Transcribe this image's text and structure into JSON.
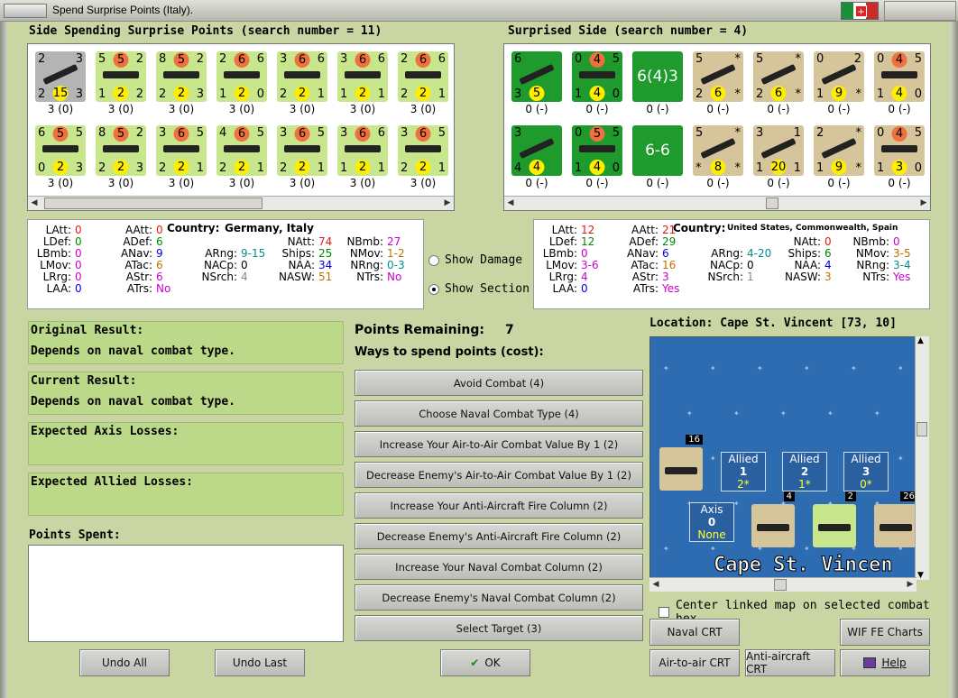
{
  "window": {
    "title": "Spend Surprise Points (Italy)."
  },
  "left_side": {
    "header": "Side Spending Surprise Points (search number = 11)",
    "row1": [
      {
        "tl": "2",
        "tr": "3",
        "bl": "2",
        "bm": "15",
        "br": "3",
        "cap": "3 (0)",
        "bg": "#b4b4b4",
        "tm": "",
        "type": "air"
      },
      {
        "tl": "5",
        "tr": "2",
        "bl": "1",
        "bm": "2",
        "br": "2",
        "cap": "3 (0)",
        "bg": "#c8e68c",
        "tm": "5",
        "type": "ship"
      },
      {
        "tl": "8",
        "tr": "2",
        "bl": "2",
        "bm": "2",
        "br": "3",
        "cap": "3 (0)",
        "bg": "#c8e68c",
        "tm": "5",
        "type": "ship"
      },
      {
        "tl": "2",
        "tr": "6",
        "bl": "1",
        "bm": "2",
        "br": "0",
        "cap": "3 (0)",
        "bg": "#c8e68c",
        "tm": "6",
        "type": "ship"
      },
      {
        "tl": "3",
        "tr": "6",
        "bl": "2",
        "bm": "2",
        "br": "1",
        "cap": "3 (0)",
        "bg": "#c8e68c",
        "tm": "6",
        "type": "ship"
      },
      {
        "tl": "3",
        "tr": "6",
        "bl": "1",
        "bm": "2",
        "br": "1",
        "cap": "3 (0)",
        "bg": "#c8e68c",
        "tm": "6",
        "type": "ship"
      },
      {
        "tl": "2",
        "tr": "6",
        "bl": "2",
        "bm": "2",
        "br": "1",
        "cap": "3 (0)",
        "bg": "#c8e68c",
        "tm": "6",
        "type": "ship"
      }
    ],
    "row2": [
      {
        "tl": "6",
        "tr": "5",
        "bl": "0",
        "bm": "2",
        "br": "3",
        "cap": "3 (0)",
        "bg": "#c8e68c",
        "tm": "5",
        "type": "ship"
      },
      {
        "tl": "8",
        "tr": "2",
        "bl": "2",
        "bm": "2",
        "br": "3",
        "cap": "3 (0)",
        "bg": "#c8e68c",
        "tm": "5",
        "type": "ship"
      },
      {
        "tl": "3",
        "tr": "5",
        "bl": "2",
        "bm": "2",
        "br": "1",
        "cap": "3 (0)",
        "bg": "#c8e68c",
        "tm": "6",
        "type": "ship"
      },
      {
        "tl": "4",
        "tr": "5",
        "bl": "2",
        "bm": "2",
        "br": "1",
        "cap": "3 (0)",
        "bg": "#c8e68c",
        "tm": "6",
        "type": "ship"
      },
      {
        "tl": "3",
        "tr": "5",
        "bl": "2",
        "bm": "2",
        "br": "1",
        "cap": "3 (0)",
        "bg": "#c8e68c",
        "tm": "6",
        "type": "ship"
      },
      {
        "tl": "3",
        "tr": "6",
        "bl": "1",
        "bm": "2",
        "br": "1",
        "cap": "3 (0)",
        "bg": "#c8e68c",
        "tm": "6",
        "type": "ship"
      },
      {
        "tl": "3",
        "tr": "5",
        "bl": "2",
        "bm": "2",
        "br": "1",
        "cap": "3 (0)",
        "bg": "#c8e68c",
        "tm": "6",
        "type": "ship"
      }
    ]
  },
  "right_side": {
    "header": "Surprised Side (search number = 4)",
    "row1": [
      {
        "tl": "6",
        "tr": "",
        "bl": "3",
        "bm": "5",
        "br": "",
        "cap": "0 (-)",
        "bg": "#1f9a2c",
        "tm": "",
        "type": "air",
        "center": ""
      },
      {
        "tl": "0",
        "tr": "5",
        "bl": "1",
        "bm": "4",
        "br": "0",
        "cap": "0 (-)",
        "bg": "#1f9a2c",
        "tm": "4",
        "type": "ship",
        "center": ""
      },
      {
        "tl": "",
        "tr": "",
        "bl": "",
        "bm": "",
        "br": "",
        "cap": "0 (-)",
        "bg": "#1f9a2c",
        "tm": "",
        "type": "box",
        "center": "6(4)3"
      },
      {
        "tl": "5",
        "tr": "*",
        "bl": "2",
        "bm": "6",
        "br": "*",
        "cap": "0 (-)",
        "bg": "#d6c49a",
        "tm": "",
        "type": "air",
        "center": ""
      },
      {
        "tl": "5",
        "tr": "*",
        "bl": "2",
        "bm": "6",
        "br": "*",
        "cap": "0 (-)",
        "bg": "#d6c49a",
        "tm": "",
        "type": "air",
        "center": ""
      },
      {
        "tl": "0",
        "tr": "2",
        "bl": "1",
        "bm": "9",
        "br": "*",
        "cap": "0 (-)",
        "bg": "#d6c49a",
        "tm": "",
        "type": "air",
        "center": ""
      },
      {
        "tl": "0",
        "tr": "5",
        "bl": "1",
        "bm": "4",
        "br": "0",
        "cap": "0 (-)",
        "bg": "#d6c49a",
        "tm": "4",
        "type": "ship",
        "center": ""
      }
    ],
    "row2": [
      {
        "tl": "3",
        "tr": "",
        "bl": "4",
        "bm": "4",
        "br": "",
        "cap": "0 (-)",
        "bg": "#1f9a2c",
        "tm": "",
        "type": "air",
        "center": ""
      },
      {
        "tl": "0",
        "tr": "5",
        "bl": "1",
        "bm": "4",
        "br": "0",
        "cap": "0 (-)",
        "bg": "#1f9a2c",
        "tm": "5",
        "type": "ship",
        "center": ""
      },
      {
        "tl": "",
        "tr": "",
        "bl": "",
        "bm": "",
        "br": "",
        "cap": "0 (-)",
        "bg": "#1f9a2c",
        "tm": "",
        "type": "box",
        "center": "6-6"
      },
      {
        "tl": "5",
        "tr": "*",
        "bl": "*",
        "bm": "8",
        "br": "*",
        "cap": "0 (-)",
        "bg": "#d6c49a",
        "tm": "",
        "type": "air",
        "center": ""
      },
      {
        "tl": "3",
        "tr": "1",
        "bl": "1",
        "bm": "20",
        "br": "1",
        "cap": "0 (-)",
        "bg": "#d6c49a",
        "tm": "",
        "type": "air",
        "center": ""
      },
      {
        "tl": "2",
        "tr": "*",
        "bl": "1",
        "bm": "9",
        "br": "*",
        "cap": "0 (-)",
        "bg": "#d6c49a",
        "tm": "",
        "type": "air",
        "center": ""
      },
      {
        "tl": "0",
        "tr": "5",
        "bl": "1",
        "bm": "3",
        "br": "0",
        "cap": "0 (-)",
        "bg": "#d6c49a",
        "tm": "4",
        "type": "ship",
        "center": ""
      }
    ]
  },
  "stats_left": {
    "country_label": "Country:",
    "country": "Germany, Italy",
    "items": [
      [
        "LAtt:",
        "0"
      ],
      [
        "LDef:",
        "0"
      ],
      [
        "LBmb:",
        "0"
      ],
      [
        "LMov:",
        "0"
      ],
      [
        "LRrg:",
        "0"
      ],
      [
        "LAA:",
        "0"
      ],
      [
        "AAtt:",
        "0"
      ],
      [
        "ADef:",
        "6"
      ],
      [
        "ANav:",
        "9"
      ],
      [
        "ATac:",
        "6"
      ],
      [
        "AStr:",
        "6"
      ],
      [
        "ATrs:",
        "No"
      ],
      [
        "ARng:",
        "9-15"
      ],
      [
        "NACp:",
        "0"
      ],
      [
        "NSrch:",
        "4"
      ],
      [
        "NAtt:",
        "74"
      ],
      [
        "Ships:",
        "25"
      ],
      [
        "NAA:",
        "34"
      ],
      [
        "NASW:",
        "51"
      ],
      [
        "NBmb:",
        "27"
      ],
      [
        "NMov:",
        "1-2"
      ],
      [
        "NRng:",
        "0-3"
      ],
      [
        "NTrs:",
        "No"
      ]
    ]
  },
  "stats_right": {
    "country_label": "Country:",
    "country": "United States, Commonwealth, Spain",
    "items": [
      [
        "LAtt:",
        "12"
      ],
      [
        "LDef:",
        "12"
      ],
      [
        "LBmb:",
        "0"
      ],
      [
        "LMov:",
        "3-6"
      ],
      [
        "LRrg:",
        "4"
      ],
      [
        "LAA:",
        "0"
      ],
      [
        "AAtt:",
        "21"
      ],
      [
        "ADef:",
        "29"
      ],
      [
        "ANav:",
        "6"
      ],
      [
        "ATac:",
        "16"
      ],
      [
        "AStr:",
        "3"
      ],
      [
        "ATrs:",
        "Yes"
      ],
      [
        "ARng:",
        "4-20"
      ],
      [
        "NACp:",
        "0"
      ],
      [
        "NSrch:",
        "1"
      ],
      [
        "NAtt:",
        "0"
      ],
      [
        "Ships:",
        "6"
      ],
      [
        "NAA:",
        "4"
      ],
      [
        "NASW:",
        "3"
      ],
      [
        "NBmb:",
        "0"
      ],
      [
        "NMov:",
        "3-5"
      ],
      [
        "NRng:",
        "3-4"
      ],
      [
        "NTrs:",
        "Yes"
      ]
    ]
  },
  "options": {
    "show_damage": "Show Damage",
    "show_section": "Show Section"
  },
  "results": {
    "orig_title": "Original Result:",
    "orig_text": "Depends on naval combat type.",
    "cur_title": "Current Result:",
    "cur_text": "Depends on naval combat type.",
    "axis_title": "Expected Axis Losses:",
    "allied_title": "Expected Allied Losses:",
    "spent_title": "Points Spent:"
  },
  "points": {
    "label": "Points Remaining:",
    "value": "7",
    "ways": "Ways to spend points (cost):"
  },
  "spend_buttons": [
    "Avoid Combat (4)",
    "Choose Naval Combat Type (4)",
    "Increase Your Air-to-Air Combat Value By 1 (2)",
    "Decrease Enemy's Air-to-Air Combat Value By 1 (2)",
    "Increase Your Anti-Aircraft Fire Column (2)",
    "Decrease Enemy's Anti-Aircraft Fire Column (2)",
    "Increase Your Naval Combat Column (2)",
    "Decrease Enemy's Naval Combat Column (2)",
    "Select Target (3)"
  ],
  "location": {
    "label": "Location: Cape St. Vincent [73, 10]",
    "map_text": "Cape St. Vincen",
    "allied": [
      {
        "t": "Allied",
        "n": "1",
        "v": "2*"
      },
      {
        "t": "Allied",
        "n": "2",
        "v": "1*"
      },
      {
        "t": "Allied",
        "n": "3",
        "v": "0*"
      }
    ],
    "axis": {
      "t": "Axis",
      "n": "0",
      "v": "None"
    },
    "stacks": [
      "16",
      "4",
      "2",
      "26"
    ],
    "center_link": "Center linked map on selected combat hex"
  },
  "bottom": {
    "undo_all": "Undo All",
    "undo_last": "Undo Last",
    "ok": "OK",
    "naval_crt": "Naval CRT",
    "wif_charts": "WIF FE Charts",
    "air_crt": "Air-to-air CRT",
    "aa_crt": "Anti-aircraft CRT",
    "help": "Help"
  },
  "colors": {
    "bg": "#c9d6a4",
    "green_box": "#bcd98a",
    "axis_counter": "#c8e68c",
    "allied_counter": "#d6c49a",
    "us_counter": "#1f9a2c",
    "sea": "#2d6cb0"
  }
}
